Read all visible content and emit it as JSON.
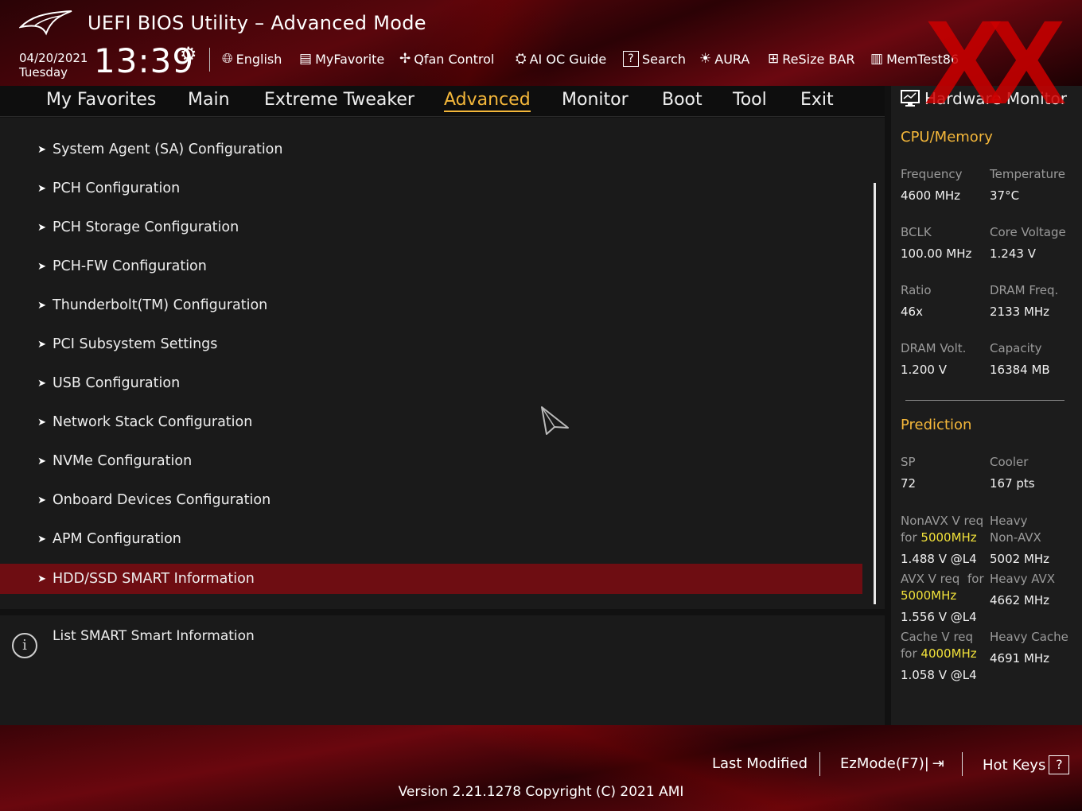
{
  "header": {
    "title": "UEFI BIOS Utility – Advanced Mode",
    "date": "04/20/2021",
    "weekday": "Tuesday",
    "time": "13:39",
    "tools": [
      {
        "label": "English",
        "icon": "globe-icon"
      },
      {
        "label": "MyFavorite",
        "icon": "favorite-list-icon"
      },
      {
        "label": "Qfan Control",
        "icon": "fan-icon"
      },
      {
        "label": "AI OC Guide",
        "icon": "cpu-guide-icon"
      },
      {
        "label": "Search",
        "icon": "search-icon"
      },
      {
        "label": "AURA",
        "icon": "aura-light-icon"
      },
      {
        "label": "ReSize BAR",
        "icon": "resize-bar-icon"
      },
      {
        "label": "MemTest86",
        "icon": "memory-icon"
      }
    ]
  },
  "nav": {
    "tabs": [
      "My Favorites",
      "Main",
      "Extreme Tweaker",
      "Advanced",
      "Monitor",
      "Boot",
      "Tool",
      "Exit"
    ],
    "active": "Advanced"
  },
  "menu": {
    "items": [
      "System Agent (SA) Configuration",
      "PCH Configuration",
      "PCH Storage Configuration",
      "PCH-FW Configuration",
      "Thunderbolt(TM) Configuration",
      "PCI Subsystem Settings",
      "USB Configuration",
      "Network Stack Configuration",
      "NVMe Configuration",
      "Onboard Devices Configuration",
      "APM Configuration",
      "HDD/SSD SMART Information"
    ],
    "selected": "HDD/SSD SMART Information"
  },
  "help": {
    "text": "List SMART Smart Information"
  },
  "hw": {
    "title": "Hardware Monitor",
    "cpu_section": "CPU/Memory",
    "frequency_label": "Frequency",
    "frequency_value": "4600 MHz",
    "temperature_label": "Temperature",
    "temperature_value": "37°C",
    "bclk_label": "BCLK",
    "bclk_value": "100.00 MHz",
    "core_voltage_label": "Core Voltage",
    "core_voltage_value": "1.243 V",
    "ratio_label": "Ratio",
    "ratio_value": "46x",
    "dram_freq_label": "DRAM Freq.",
    "dram_freq_value": "2133 MHz",
    "dram_volt_label": "DRAM Volt.",
    "dram_volt_value": "1.200 V",
    "capacity_label": "Capacity",
    "capacity_value": "16384 MB",
    "prediction_section": "Prediction",
    "sp_label": "SP",
    "sp_value": "72",
    "cooler_label": "Cooler",
    "cooler_value": "167 pts",
    "nonavx_label_1": "NonAVX V req",
    "nonavx_label_2a": "for ",
    "nonavx_label_2b": "5000MHz",
    "nonavx_value": "1.488 V @L4",
    "heavy_nonavx_label_1": "Heavy",
    "heavy_nonavx_label_2": "Non-AVX",
    "heavy_nonavx_value": "5002 MHz",
    "avx_label_1": "AVX V req",
    "avx_label_for": "for",
    "avx_label_2": "5000MHz",
    "avx_value": "1.556 V @L4",
    "heavy_avx_label": "Heavy AVX",
    "heavy_avx_value": "4662 MHz",
    "cache_label_1": "Cache V req",
    "cache_label_2a": "for ",
    "cache_label_2b": "4000MHz",
    "cache_value": "1.058 V @L4",
    "heavy_cache_label": "Heavy Cache",
    "heavy_cache_value": "4691 MHz"
  },
  "footer": {
    "last_modified": "Last Modified",
    "ezmode": "EzMode(F7)|",
    "hot_keys": "Hot Keys",
    "hot_keys_icon": "?",
    "version": "Version 2.21.1278 Copyright (C) 2021 AMI"
  },
  "colors": {
    "accent": "#f4b73a",
    "selected_row": "#6e0d12",
    "highlight_freq": "#f2e23a"
  }
}
